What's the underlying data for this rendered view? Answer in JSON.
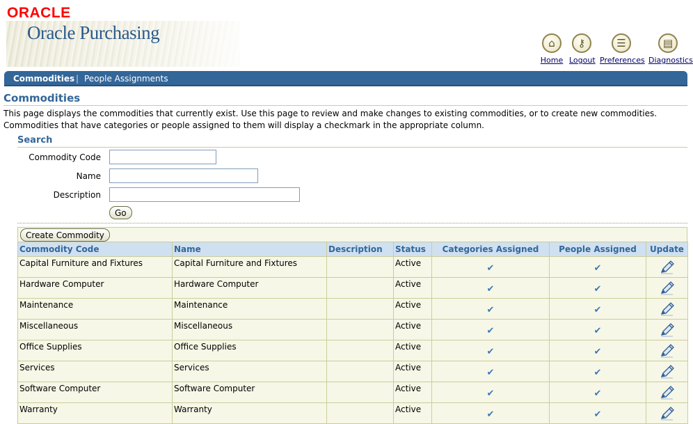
{
  "brand": {
    "company": "ORACLE",
    "product": "Oracle Purchasing"
  },
  "global_links": [
    {
      "label": "Home",
      "icon": "home-icon"
    },
    {
      "label": "Logout",
      "icon": "logout-key-icon"
    },
    {
      "label": "Preferences",
      "icon": "preferences-icon"
    },
    {
      "label": "Diagnostics",
      "icon": "diagnostics-icon"
    }
  ],
  "tabs": [
    {
      "label": "Commodities",
      "active": true
    },
    {
      "label": "People Assignments",
      "active": false
    }
  ],
  "tab_separator": "|",
  "page": {
    "title": "Commodities",
    "description": "This page displays the commodities that currently exist. Use this page to review and make changes to existing commodities, or to create new commodities. Commodities that have categories or people assigned to them will display a checkmark in the appropriate column."
  },
  "search": {
    "title": "Search",
    "fields": [
      {
        "label": "Commodity Code",
        "value": ""
      },
      {
        "label": "Name",
        "value": ""
      },
      {
        "label": "Description",
        "value": ""
      }
    ],
    "go_label": "Go"
  },
  "results": {
    "create_label": "Create Commodity",
    "columns": [
      "Commodity Code",
      "Name",
      "Description",
      "Status",
      "Categories Assigned",
      "People Assigned",
      "Update"
    ],
    "rows": [
      {
        "code": "Capital Furniture and Fixtures",
        "name": "Capital Furniture and Fixtures",
        "description": "",
        "status": "Active",
        "categories": true,
        "people": true
      },
      {
        "code": "Hardware Computer",
        "name": "Hardware Computer",
        "description": "",
        "status": "Active",
        "categories": true,
        "people": true
      },
      {
        "code": "Maintenance",
        "name": "Maintenance",
        "description": "",
        "status": "Active",
        "categories": true,
        "people": true
      },
      {
        "code": "Miscellaneous",
        "name": "Miscellaneous",
        "description": "",
        "status": "Active",
        "categories": true,
        "people": true
      },
      {
        "code": "Office Supplies",
        "name": "Office Supplies",
        "description": "",
        "status": "Active",
        "categories": true,
        "people": true
      },
      {
        "code": "Services",
        "name": "Services",
        "description": "",
        "status": "Active",
        "categories": true,
        "people": true
      },
      {
        "code": "Software Computer",
        "name": "Software Computer",
        "description": "",
        "status": "Active",
        "categories": true,
        "people": true
      },
      {
        "code": "Warranty",
        "name": "Warranty",
        "description": "",
        "status": "Active",
        "categories": true,
        "people": true
      }
    ]
  },
  "colors": {
    "tab_bar": "#336699",
    "header_text": "#336699",
    "oracle_red": "#ff0000",
    "check": "#3a78b8"
  }
}
